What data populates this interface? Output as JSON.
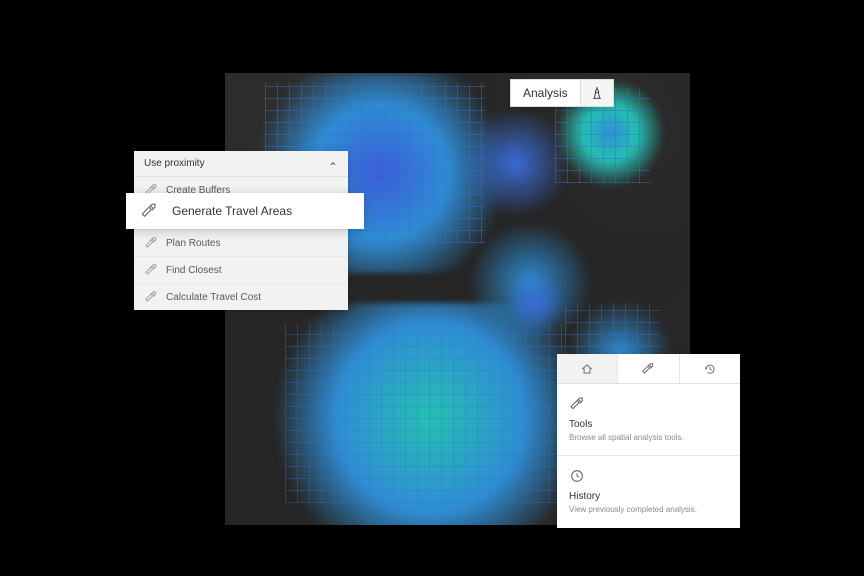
{
  "analysis_button": {
    "label": "Analysis"
  },
  "proximity_panel": {
    "header": "Use proximity",
    "tools": [
      {
        "label": "Create Buffers"
      },
      {
        "label": "Generate Travel Areas",
        "highlighted": true
      },
      {
        "label": "Plan Routes"
      },
      {
        "label": "Find Closest"
      },
      {
        "label": "Calculate Travel Cost"
      }
    ]
  },
  "tools_panel": {
    "tools": {
      "title": "Tools",
      "description": "Browse all spatial analysis tools."
    },
    "history": {
      "title": "History",
      "description": "View previously completed analysis."
    }
  }
}
